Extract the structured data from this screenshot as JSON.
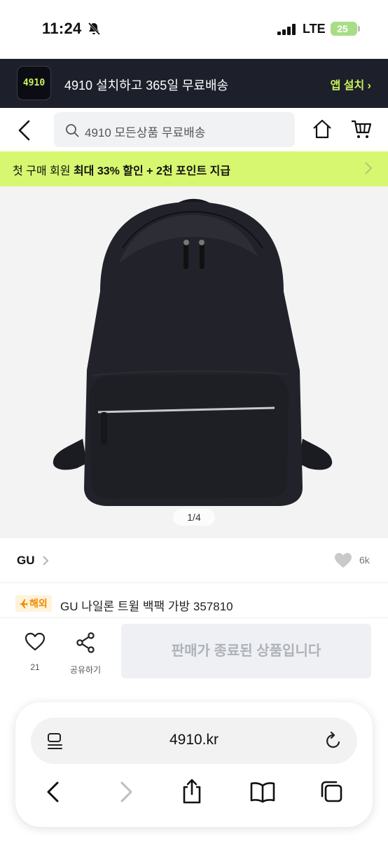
{
  "status_bar": {
    "time": "11:24",
    "network": "LTE",
    "battery": "25"
  },
  "install_banner": {
    "logo_text": "4910",
    "message": "4910 설치하고 365일 무료배송",
    "button": "앱 설치 ›"
  },
  "search": {
    "placeholder": "4910 모든상품 무료배송"
  },
  "promo": {
    "text_pre": "첫 구매 회원 ",
    "text_bold": "최대 33% 할인 + 2천 포인트 지급"
  },
  "product": {
    "image_counter": "1/4",
    "brand": "GU",
    "like_count": "6k",
    "badge": "해외",
    "title": "GU 나일론 트윌 백팩 가방 357810"
  },
  "actions": {
    "like_count": "21",
    "share_label": "공유하기",
    "sold_out": "판매가 종료된 상품입니다"
  },
  "browser": {
    "url": "4910.kr"
  },
  "colors": {
    "accent_lime": "#d8f770",
    "banner_dark": "#1d1f2b",
    "install_green": "#c9f35b",
    "overseas_orange": "#f08a00"
  }
}
